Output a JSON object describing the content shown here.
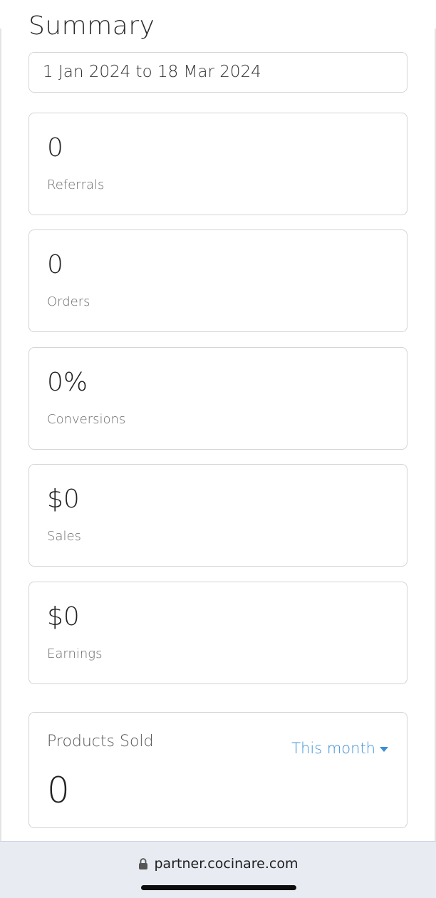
{
  "summary": {
    "title": "Summary",
    "date_range": "1 Jan 2024 to 18 Mar 2024"
  },
  "stats": [
    {
      "value": "0",
      "label": "Referrals"
    },
    {
      "value": "0",
      "label": "Orders"
    },
    {
      "value": "0%",
      "label": "Conversions"
    },
    {
      "value": "$0",
      "label": "Sales"
    },
    {
      "value": "$0",
      "label": "Earnings"
    }
  ],
  "products_sold": {
    "title": "Products Sold",
    "period": "This month",
    "value": "0"
  },
  "browser": {
    "url": "partner.cocinare.com",
    "lock_icon": "lock-icon"
  },
  "colors": {
    "accent": "#3a8fd6",
    "border": "#d4d4d4",
    "browser_bar": "#e8ecf2"
  }
}
